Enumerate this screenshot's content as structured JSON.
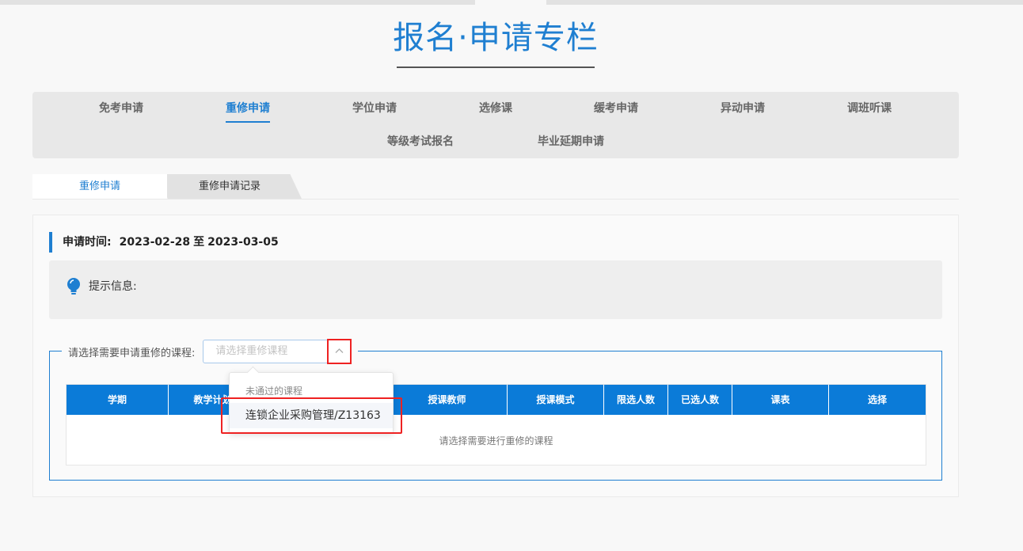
{
  "page": {
    "title": "报名·申请专栏"
  },
  "nav": {
    "items": [
      {
        "label": "免考申请",
        "active": false
      },
      {
        "label": "重修申请",
        "active": true
      },
      {
        "label": "学位申请",
        "active": false
      },
      {
        "label": "选修课",
        "active": false
      },
      {
        "label": "缓考申请",
        "active": false
      },
      {
        "label": "异动申请",
        "active": false
      },
      {
        "label": "调班听课",
        "active": false
      },
      {
        "label": "等级考试报名",
        "active": false
      },
      {
        "label": "毕业延期申请",
        "active": false
      }
    ]
  },
  "subtabs": [
    {
      "label": "重修申请",
      "active": true
    },
    {
      "label": "重修申请记录",
      "active": false
    }
  ],
  "apply": {
    "label": "申请时间:",
    "start": "2023-02-28",
    "sep": "至",
    "end": "2023-03-05"
  },
  "tips": {
    "label": "提示信息:",
    "icon": "lightbulb-icon"
  },
  "select": {
    "label": "请选择需要申请重修的课程:",
    "placeholder": "请选择重修课程",
    "icon": "chevron-up-icon"
  },
  "dropdown": {
    "group": "未通过的课程",
    "option": "连锁企业采购管理/Z13163"
  },
  "table": {
    "headers": [
      "学期",
      "教学计划",
      "",
      "授课教师",
      "授课模式",
      "限选人数",
      "已选人数",
      "课表",
      "选择"
    ],
    "empty_text": "请选择需要进行重修的课程"
  },
  "colors": {
    "accent": "#1f7fd1",
    "header_bg": "#0b7bd8",
    "highlight": "#ee2222"
  }
}
